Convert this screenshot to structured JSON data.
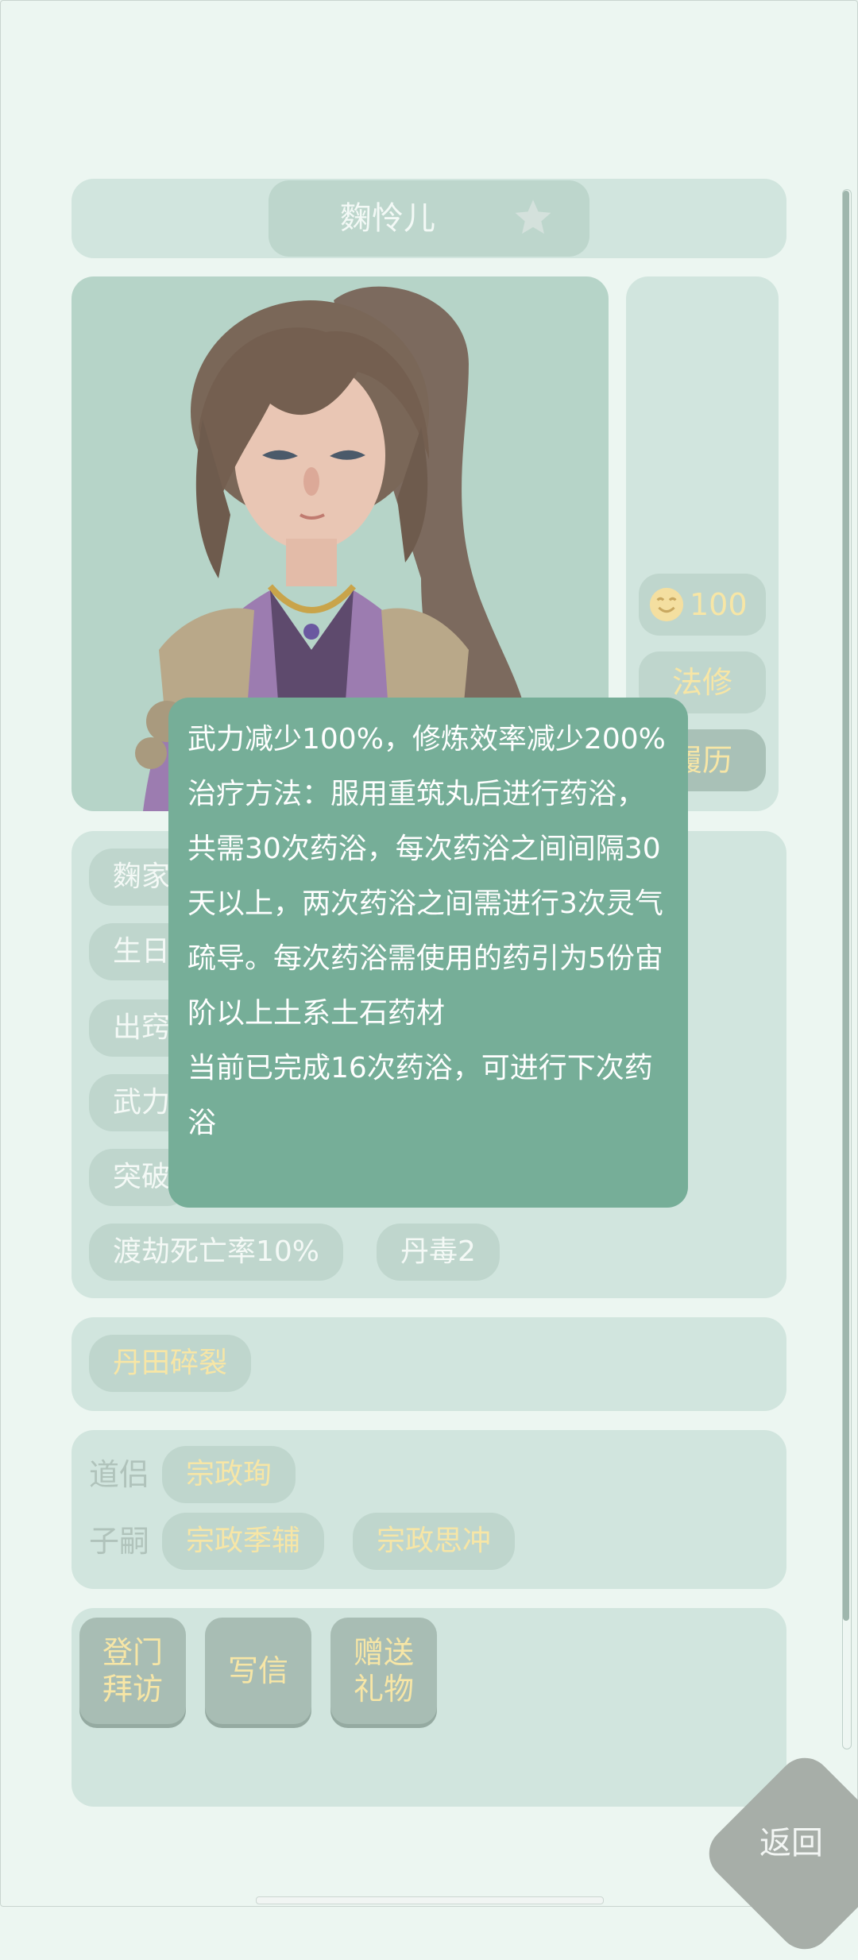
{
  "character": {
    "name": "麴怜儿"
  },
  "side": {
    "mood_value": "100",
    "type_label": "法修",
    "history_label": "履历"
  },
  "attributes": {
    "chips": [
      "麴家",
      "生日",
      "出窍",
      "武力",
      "突破"
    ],
    "row6": [
      "渡劫死亡率10%",
      "丹毒2"
    ]
  },
  "condition": {
    "label": "丹田碎裂"
  },
  "relations": {
    "partner_label": "道侣",
    "partners": [
      "宗政珣"
    ],
    "children_label": "子嗣",
    "children": [
      "宗政季辅",
      "宗政思冲"
    ]
  },
  "actions": {
    "visit": "登门\n拜访",
    "letter": "写信",
    "gift": "赠送\n礼物"
  },
  "back_label": "返回",
  "tooltip": {
    "effect": "武力减少100%，修炼效率减少200%",
    "treatment": "治疗方法：服用重筑丸后进行药浴，共需30次药浴，每次药浴之间间隔30天以上，两次药浴之间需进行3次灵气疏导。每次药浴需使用的药引为5份宙阶以上土系土石药材",
    "progress": "当前已完成16次药浴，可进行下次药浴"
  },
  "colors": {
    "background": "#ecf6f1",
    "panel": "#d1e5de",
    "tooltip": "#76ae98",
    "gold_text": "#f7e6a6"
  },
  "icons": {
    "favorite": "star-icon",
    "mood": "smile-icon"
  }
}
